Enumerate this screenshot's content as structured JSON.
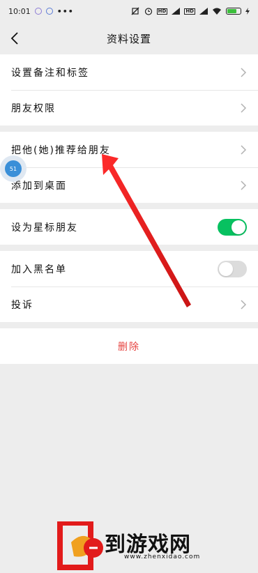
{
  "statusbar": {
    "time": "10:01",
    "more": "•••",
    "hd1": "HD",
    "hd2": "HD"
  },
  "header": {
    "title": "资料设置"
  },
  "group1": {
    "items": [
      {
        "label": "设置备注和标签"
      },
      {
        "label": "朋友权限"
      }
    ]
  },
  "group2": {
    "items": [
      {
        "label": "把他(她)推荐给朋友"
      },
      {
        "label": "添加到桌面"
      }
    ]
  },
  "group3": {
    "star_label": "设为星标朋友",
    "star_on": true
  },
  "group4": {
    "blacklist_label": "加入黑名单",
    "blacklist_on": false,
    "complain_label": "投诉"
  },
  "group5": {
    "delete_label": "删除"
  },
  "float_bubble": {
    "text": "51"
  },
  "watermark": {
    "text": "到游戏网",
    "url": "www.zhenxidao.com"
  },
  "colors": {
    "accent_green": "#07c160",
    "danger_red": "#e64340",
    "arrow_red": "#e21b1b",
    "background": "#ededed"
  },
  "icons": [
    "back-arrow-icon",
    "chevron-right-icon",
    "toggle-switch",
    "red-arrow-annotation"
  ]
}
